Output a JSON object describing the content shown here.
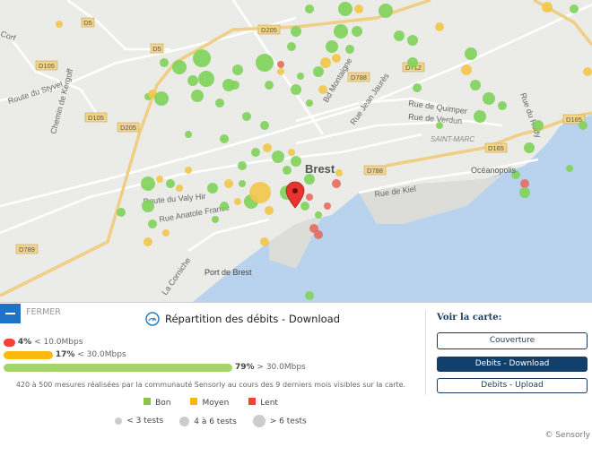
{
  "map": {
    "road_labels": [
      "D5",
      "D5",
      "D105",
      "D105",
      "D205",
      "D205",
      "D712",
      "D788",
      "D788",
      "D165",
      "D165",
      "D789"
    ],
    "street_labels": [
      "Route du Styvel",
      "Chemin de Kergoff",
      "Bd Montaigne",
      "Rue Jean Jaurès",
      "Rue de Quimper",
      "Rue de Verdun",
      "Rue du Rody",
      "Route du Valy Hir",
      "Rue Anatole France",
      "Rue de Kiel",
      "La Corniche",
      "Corf"
    ],
    "place_labels": {
      "city": "Brest",
      "district": "SAINT-MARC",
      "poi1": "Océanopolis",
      "poi2": "Port de Brest"
    }
  },
  "panel": {
    "close_label": "FERMER",
    "title": "Répartition des débits - Download",
    "bars": [
      {
        "percent": "4%",
        "range": "< 10.0Mbps",
        "value": 4,
        "color": "#f44336"
      },
      {
        "percent": "17%",
        "range": "< 30.0Mbps",
        "value": 17,
        "color": "#fbb80f"
      },
      {
        "percent": "79%",
        "range": "> 30.0Mbps",
        "value": 79,
        "color": "#a5d46a"
      }
    ],
    "note": "420 à 500 mesures réalisées par la communauté Sensorly au cours des 9 derniers mois visibles sur la carte.",
    "legend_colors": [
      {
        "label": "Bon",
        "color": "#8bc34a"
      },
      {
        "label": "Moyen",
        "color": "#fbb80f"
      },
      {
        "label": "Lent",
        "color": "#f44336"
      }
    ],
    "legend_sizes": [
      "< 3 tests",
      "4 à 6 tests",
      "> 6 tests"
    ],
    "view_title": "Voir la carte:",
    "view_buttons": [
      "Couverture",
      "Debits - Download",
      "Debits - Upload"
    ],
    "active_view": "Debits - Download",
    "copyright": "© Sensorly"
  }
}
